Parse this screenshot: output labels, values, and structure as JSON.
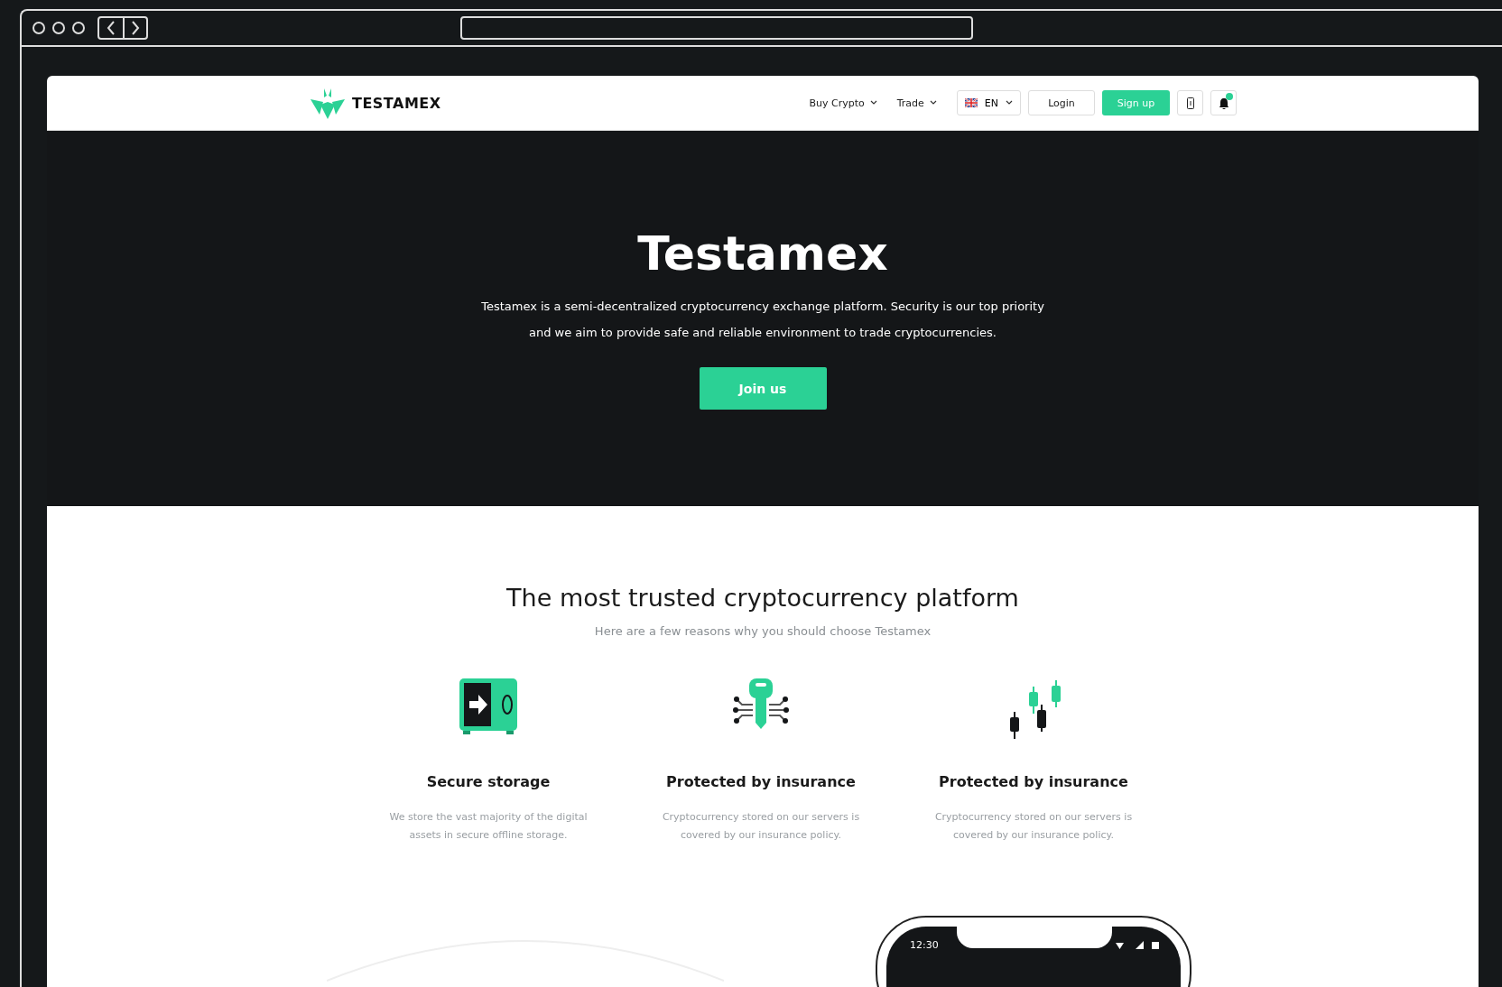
{
  "brand": {
    "name": "TESTAMEX"
  },
  "nav": {
    "menus": [
      {
        "label": "Buy Crypto"
      },
      {
        "label": "Trade"
      }
    ],
    "language": {
      "label": "EN"
    },
    "login": "Login",
    "signup": "Sign up",
    "notifications": {
      "unread": true
    }
  },
  "hero": {
    "title": "Testamex",
    "text": "Testamex is a semi-decentralized cryptocurrency exchange platform. Security is our top priority and we aim to provide safe and reliable environment to trade cryptocurrencies.",
    "button": "Join us"
  },
  "features": {
    "title": "The most trusted cryptocurrency platform",
    "subtitle": "Here are a few reasons why you should choose Testamex",
    "items": [
      {
        "kind": "safe",
        "title": "Secure storage",
        "text": "We store the vast majority of the digital assets in secure offline storage."
      },
      {
        "kind": "key",
        "title": "Protected by insurance",
        "text": "Cryptocurrency stored on our servers is covered by our insurance policy."
      },
      {
        "kind": "candles",
        "title": "Protected by insurance",
        "text": "Cryptocurrency stored on our servers is covered by our insurance policy."
      }
    ]
  },
  "phone": {
    "time": "12:30"
  }
}
